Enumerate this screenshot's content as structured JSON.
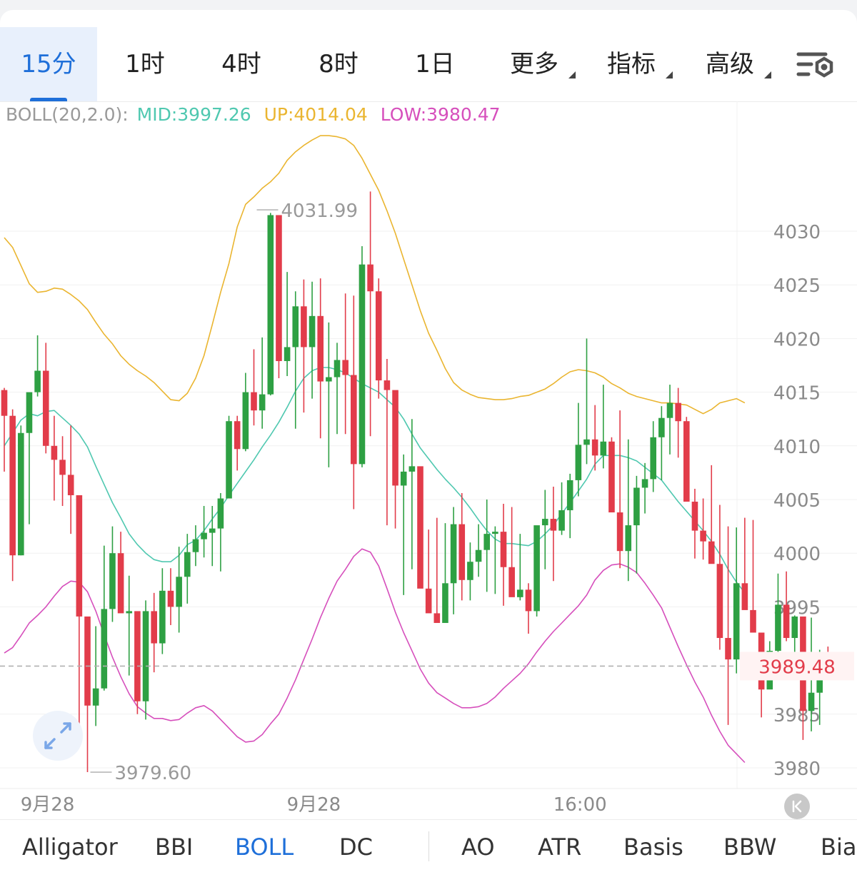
{
  "tabs": [
    {
      "label": "15分",
      "active": true
    },
    {
      "label": "1时"
    },
    {
      "label": "4时"
    },
    {
      "label": "8时"
    },
    {
      "label": "1日"
    },
    {
      "label": "更多",
      "dropdown": true
    },
    {
      "label": "指标",
      "dropdown": true
    },
    {
      "label": "高级",
      "dropdown": true
    }
  ],
  "settings_icon": "chart-settings-icon",
  "legend": {
    "indicator": "BOLL(20,2.0):",
    "mid": "MID:3997.26",
    "up": "UP:4014.04",
    "low": "LOW:3980.47"
  },
  "colors": {
    "up_candle": "#2ea043",
    "down_candle": "#e23c4a",
    "mid": "#4fc8b0",
    "upper": "#eab530",
    "lower": "#d64fbc",
    "accent": "#1e6fd9",
    "price_label": "#e23c4a",
    "legend_label": "#999999"
  },
  "chart_data": {
    "type": "candlestick",
    "indicator": "BOLL(20,2.0)",
    "ylim": [
      3978.2,
      4042
    ],
    "y_ticks": [
      4030,
      4025,
      4020,
      4015,
      4010,
      4005,
      4000,
      3995,
      3985,
      3980
    ],
    "y_tick_labels": [
      "4030",
      "4025",
      "4020",
      "4015",
      "4010",
      "4005",
      "4000",
      "3995",
      "3985",
      "3980"
    ],
    "x_labels": [
      "9月28",
      "9月28",
      "16:00"
    ],
    "x_label_candle_index": [
      4,
      36,
      68
    ],
    "current_price": 3989.48,
    "current_price_label": "3989.48",
    "annotations": [
      {
        "label": "4031.99",
        "value": 4031.99,
        "candle_index": 30
      },
      {
        "label": "3979.60",
        "value": 3979.6,
        "candle_index": 10
      }
    ],
    "candles": [
      [
        4015.2,
        4015.4,
        4007.6,
        4012.8
      ],
      [
        4012.8,
        4013.4,
        3997.4,
        3999.8
      ],
      [
        3999.8,
        4011.9,
        3999.8,
        4011.2
      ],
      [
        4011.2,
        4014.6,
        4002.7,
        4015.0
      ],
      [
        4015.0,
        4020.3,
        4014.6,
        4017.0
      ],
      [
        4017.0,
        4019.6,
        4009.3,
        4010.0
      ],
      [
        4010.0,
        4012.8,
        4004.9,
        4008.7
      ],
      [
        4008.7,
        4010.9,
        4004.4,
        4007.3
      ],
      [
        4007.3,
        4011.9,
        4001.8,
        4005.4
      ],
      [
        4005.4,
        4004.8,
        3983.0,
        3994.1
      ],
      [
        3994.1,
        3992.5,
        3979.6,
        3985.8
      ],
      [
        3985.8,
        3993.2,
        3983.9,
        3987.4
      ],
      [
        3987.4,
        4000.7,
        3987.2,
        3994.8
      ],
      [
        3994.8,
        4002.5,
        3993.6,
        4000.0
      ],
      [
        4000.0,
        4002.0,
        3994.6,
        3994.4
      ],
      [
        3994.4,
        3997.9,
        3988.6,
        3994.6
      ],
      [
        3994.6,
        3994.4,
        3985.0,
        3986.2
      ],
      [
        3986.2,
        3995.6,
        3984.5,
        3994.6
      ],
      [
        3994.6,
        3996.3,
        3988.9,
        3991.6
      ],
      [
        3991.6,
        3998.6,
        3990.6,
        3996.5
      ],
      [
        3996.5,
        3998.6,
        3993.3,
        3995.0
      ],
      [
        3995.0,
        4000.6,
        3992.6,
        3997.8
      ],
      [
        3997.8,
        4001.8,
        3995.3,
        4000.1
      ],
      [
        4000.1,
        4002.6,
        3998.8,
        4001.3
      ],
      [
        4001.3,
        4004.4,
        3999.6,
        4001.9
      ],
      [
        4001.9,
        4004.4,
        3998.8,
        4002.3
      ],
      [
        4002.3,
        4005.6,
        3998.3,
        4005.1
      ],
      [
        4005.1,
        4012.8,
        4005.1,
        4012.3
      ],
      [
        4012.3,
        4012.8,
        4007.7,
        4009.7
      ],
      [
        4009.7,
        4016.8,
        4009.5,
        4015.0
      ],
      [
        4015.0,
        4019.0,
        4011.9,
        4013.3
      ],
      [
        4013.3,
        4020.1,
        4011.6,
        4014.8
      ],
      [
        4014.8,
        4031.7,
        4014.7,
        4031.5
      ],
      [
        4031.5,
        4030.6,
        4016.3,
        4017.9
      ],
      [
        4017.9,
        4026.2,
        4016.5,
        4019.2
      ],
      [
        4019.2,
        4024.4,
        4011.6,
        4023.0
      ],
      [
        4023.0,
        4025.5,
        4013.1,
        4019.2
      ],
      [
        4019.2,
        4025.3,
        4014.4,
        4022.1
      ],
      [
        4022.1,
        4025.6,
        4010.7,
        4016.0
      ],
      [
        4016.0,
        4021.5,
        4008.0,
        4016.4
      ],
      [
        4016.4,
        4019.6,
        4011.1,
        4018.0
      ],
      [
        4018.0,
        4024.2,
        4011.1,
        4016.6
      ],
      [
        4016.6,
        4024.0,
        4004.1,
        4008.3
      ],
      [
        4008.3,
        4028.6,
        4008.0,
        4026.9
      ],
      [
        4026.9,
        4033.7,
        4010.9,
        4024.4
      ],
      [
        4024.4,
        4025.6,
        4014.4,
        4016.1
      ],
      [
        4016.1,
        4018.1,
        4002.6,
        4015.2
      ],
      [
        4015.2,
        4014.6,
        4002.3,
        4006.3
      ],
      [
        4006.3,
        4009.2,
        3996.1,
        4007.6
      ],
      [
        4007.6,
        4012.5,
        3998.5,
        4008.1
      ],
      [
        4008.1,
        4005.6,
        3998.2,
        3996.7
      ],
      [
        3996.7,
        4002.2,
        3995.1,
        3994.4
      ],
      [
        3994.4,
        4003.3,
        3993.8,
        3993.5
      ],
      [
        3993.5,
        4002.8,
        3994.1,
        3997.2
      ],
      [
        3997.2,
        4004.3,
        3994.3,
        4002.7
      ],
      [
        4002.7,
        4005.6,
        3995.6,
        3997.5
      ],
      [
        3997.5,
        4001.0,
        3995.6,
        3999.2
      ],
      [
        3999.2,
        4002.7,
        3997.8,
        4000.3
      ],
      [
        4000.3,
        4005.0,
        3996.4,
        4001.8
      ],
      [
        4001.8,
        4002.5,
        3996.2,
        4002.0
      ],
      [
        4002.0,
        4004.6,
        3995.1,
        3998.7
      ],
      [
        3998.7,
        4004.3,
        3997.5,
        3995.9
      ],
      [
        3995.9,
        4001.8,
        3995.6,
        3996.6
      ],
      [
        3996.6,
        3997.2,
        3992.5,
        3994.6
      ],
      [
        3994.6,
        4002.3,
        3994.1,
        4002.6
      ],
      [
        4002.6,
        4005.9,
        3998.5,
        4003.2
      ],
      [
        4003.2,
        4006.2,
        3997.4,
        4002.1
      ],
      [
        4002.1,
        4006.6,
        4001.7,
        4004.0
      ],
      [
        4004.0,
        4007.4,
        4001.4,
        4006.8
      ],
      [
        4006.8,
        4014.0,
        4005.3,
        4010.1
      ],
      [
        4010.1,
        4020.0,
        4008.3,
        4010.6
      ],
      [
        4010.6,
        4013.8,
        4007.7,
        4009.1
      ],
      [
        4009.1,
        4015.7,
        4007.9,
        4010.4
      ],
      [
        4010.4,
        4010.8,
        4004.6,
        4003.8
      ],
      [
        4003.8,
        4013.3,
        3998.6,
        4000.2
      ],
      [
        4000.2,
        4010.6,
        3997.4,
        4002.6
      ],
      [
        4002.6,
        4007.2,
        3998.1,
        4006.1
      ],
      [
        4006.1,
        4008.4,
        4003.7,
        4006.9
      ],
      [
        4006.9,
        4012.3,
        4005.7,
        4010.8
      ],
      [
        4010.8,
        4013.7,
        4006.8,
        4012.6
      ],
      [
        4012.6,
        4015.7,
        4009.2,
        4014.0
      ],
      [
        4014.0,
        4015.4,
        4008.9,
        4012.3
      ],
      [
        4012.3,
        4012.7,
        4005.5,
        4004.8
      ],
      [
        4004.8,
        4006.0,
        3999.5,
        4002.1
      ],
      [
        4002.1,
        4005.1,
        3999.4,
        4001.1
      ],
      [
        4001.1,
        4008.2,
        3999.2,
        3999.0
      ],
      [
        3999.0,
        4004.5,
        3991.0,
        3992.1
      ],
      [
        3992.1,
        4002.5,
        3984.0,
        3990.1
      ],
      [
        3990.1,
        4002.4,
        3988.8,
        3997.2
      ],
      [
        3997.2,
        4003.3,
        3996.0,
        3994.7
      ],
      [
        3994.7,
        4003.1,
        3993.4,
        3992.6
      ],
      [
        3992.6,
        3992.6,
        3984.7,
        3987.3
      ],
      [
        3987.3,
        3991.8,
        3987.9,
        3990.9
      ],
      [
        3990.9,
        3998.1,
        3990.2,
        3995.2
      ],
      [
        3995.2,
        3998.3,
        3991.8,
        3992.1
      ],
      [
        3992.1,
        3994.2,
        3990.2,
        3994.1
      ],
      [
        3994.1,
        3991.1,
        3982.6,
        3985.3
      ],
      [
        3985.3,
        3994.0,
        3983.4,
        3987.0
      ],
      [
        3987.0,
        3991.0,
        3984.0,
        3989.9
      ],
      [
        3989.9,
        3991.3,
        3988.6,
        3988.9
      ]
    ],
    "series": [
      {
        "name": "MID",
        "values": [
          4010.0,
          4011.2,
          4012.4,
          4013.0,
          4012.8,
          4013.2,
          4013.3,
          4012.6,
          4011.9,
          4011.1,
          4009.9,
          4008.1,
          4006.4,
          4004.7,
          4003.3,
          4001.8,
          4000.8,
          4000.0,
          3999.4,
          3999.2,
          3999.2,
          3999.8,
          4000.8,
          4001.2,
          4002.1,
          4003.2,
          4004.2,
          4005.4,
          4006.5,
          4007.6,
          4008.7,
          4009.9,
          4011.0,
          4012.2,
          4013.6,
          4015.1,
          4016.3,
          4017.0,
          4017.3,
          4017.3,
          4017.1,
          4016.8,
          4016.3,
          4015.8,
          4015.4,
          4015.0,
          4014.3,
          4013.6,
          4012.5,
          4011.1,
          4009.8,
          4008.8,
          4007.8,
          4006.9,
          4006.1,
          4005.2,
          4004.2,
          4003.1,
          4002.1,
          4001.3,
          4000.9,
          4000.9,
          4000.8,
          4000.7,
          4001.1,
          4001.8,
          4002.6,
          4003.7,
          4004.7,
          4005.8,
          4006.9,
          4008.3,
          4009.1,
          4009.1,
          4009.1,
          4008.9,
          4008.6,
          4008.0,
          4007.4,
          4006.8,
          4005.8,
          4004.8,
          4003.9,
          4003.0,
          4002.1,
          4001.1,
          3999.9,
          3998.5,
          3997.3,
          3996.3
        ]
      },
      {
        "name": "UP",
        "values": [
          4029.4,
          4028.5,
          4026.8,
          4025.1,
          4024.3,
          4024.4,
          4024.7,
          4024.6,
          4024.1,
          4023.5,
          4022.7,
          4021.5,
          4020.4,
          4019.5,
          4018.4,
          4017.6,
          4017.0,
          4016.5,
          4015.9,
          4015.1,
          4014.3,
          4014.2,
          4014.9,
          4016.3,
          4018.4,
          4021.3,
          4024.3,
          4027.0,
          4030.4,
          4032.5,
          4033.2,
          4034.0,
          4034.6,
          4035.4,
          4036.6,
          4037.4,
          4038.0,
          4038.5,
          4038.9,
          4038.9,
          4038.8,
          4038.6,
          4038.0,
          4036.8,
          4035.3,
          4033.8,
          4031.9,
          4029.8,
          4027.4,
          4025.0,
          4022.6,
          4020.5,
          4018.9,
          4017.2,
          4015.9,
          4015.2,
          4014.8,
          4014.5,
          4014.4,
          4014.3,
          4014.3,
          4014.4,
          4014.6,
          4014.7,
          4015.0,
          4015.3,
          4015.8,
          4016.4,
          4016.9,
          4017.1,
          4017.0,
          4016.8,
          4016.4,
          4015.8,
          4015.4,
          4014.9,
          4014.6,
          4014.4,
          4014.2,
          4014.0,
          4014.0,
          4013.9,
          4013.8,
          4013.4,
          4013.0,
          4013.4,
          4014.0,
          4014.2,
          4014.4,
          4014.0
        ]
      },
      {
        "name": "LOW",
        "values": [
          3990.7,
          3991.2,
          3992.3,
          3993.5,
          3994.2,
          3995.0,
          3996.0,
          3996.9,
          3997.4,
          3997.3,
          3996.4,
          3994.6,
          3992.4,
          3990.3,
          3988.5,
          3986.9,
          3985.7,
          3985.1,
          3984.6,
          3984.6,
          3984.4,
          3984.5,
          3985.1,
          3985.6,
          3985.8,
          3985.3,
          3984.5,
          3983.7,
          3982.9,
          3982.4,
          3982.5,
          3983.1,
          3984.1,
          3985.0,
          3986.5,
          3988.2,
          3990.1,
          3992.0,
          3994.0,
          3995.8,
          3997.4,
          3998.5,
          3999.7,
          4000.4,
          4000.1,
          3998.8,
          3996.7,
          3994.5,
          3992.6,
          3990.9,
          3989.2,
          3987.9,
          3987.0,
          3986.5,
          3986.0,
          3985.6,
          3985.6,
          3985.7,
          3986.0,
          3986.6,
          3987.4,
          3988.1,
          3988.8,
          3989.7,
          3990.8,
          3991.8,
          3992.7,
          3993.5,
          3994.3,
          3995.1,
          3996.1,
          3997.5,
          3998.4,
          3998.9,
          3999.0,
          3998.7,
          3998.2,
          3997.2,
          3996.1,
          3994.9,
          3993.1,
          3991.3,
          3989.6,
          3988.0,
          3986.6,
          3984.9,
          3983.4,
          3982.1,
          3981.3,
          3980.5
        ]
      }
    ]
  },
  "indicators": [
    {
      "label": "Alligator"
    },
    {
      "label": "BBI"
    },
    {
      "label": "BOLL",
      "active": true
    },
    {
      "label": "DC"
    },
    {
      "label": "AO"
    },
    {
      "label": "ATR"
    },
    {
      "label": "Basis"
    },
    {
      "label": "BBW"
    },
    {
      "label": "Bias"
    }
  ]
}
